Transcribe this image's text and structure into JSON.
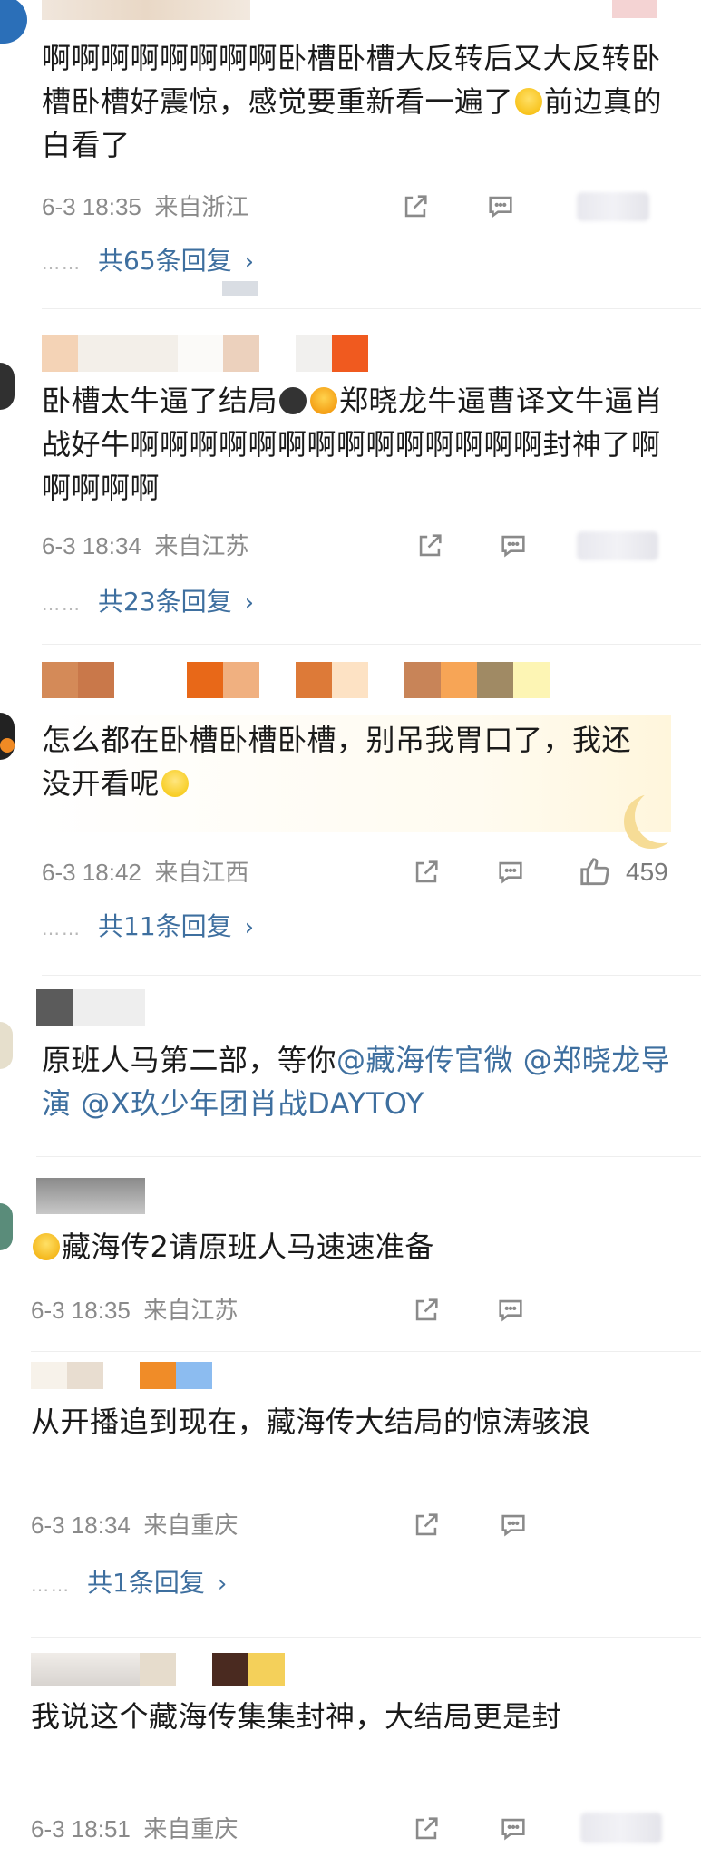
{
  "comments": [
    {
      "text": "啊啊啊啊啊啊啊啊卧槽卧槽大反转后又大反转卧槽卧槽好震惊，感觉要重新看一遍了",
      "text_tail": "前边真的白看了",
      "date": "6-3 18:35",
      "location": "来自浙江",
      "replies_label": "共65条回复"
    },
    {
      "text_head": "卧槽太牛逼了结局",
      "text": "郑晓龙牛逼曹译文牛逼肖战好牛啊啊啊啊啊啊啊啊啊啊啊啊啊啊封神了啊啊啊啊啊",
      "date": "6-3 18:34",
      "location": "来自江苏",
      "replies_label": "共23条回复"
    },
    {
      "text": "怎么都在卧槽卧槽卧槽，别吊我胃口了，我还没开看呢",
      "date": "6-3 18:42",
      "location": "来自江西",
      "likes": "459",
      "replies_label": "共11条回复"
    },
    {
      "text_head": "原班人马第二部，等你",
      "mention_1": "@藏海传官微",
      "mention_2": "@郑晓龙导演",
      "mention_3": "@X玖少年团肖战DAYTOY"
    },
    {
      "text": "藏海传2请原班人马速速准备",
      "date": "6-3 18:35",
      "location": "来自江苏"
    },
    {
      "text": "从开播追到现在，藏海传大结局的惊涛骇浪",
      "date": "6-3 18:34",
      "location": "来自重庆",
      "replies_label": "共1条回复"
    },
    {
      "text": "我说这个藏海传集集封神，大结局更是封",
      "date": "6-3 18:51",
      "location": "来自重庆"
    }
  ],
  "icons": {
    "share": "share-icon",
    "comment": "comment-icon",
    "like": "thumbs-up-icon",
    "chevron": "chevron-right-icon"
  },
  "colors": {
    "link": "#3e6f9f",
    "meta": "#8a8a8a"
  }
}
